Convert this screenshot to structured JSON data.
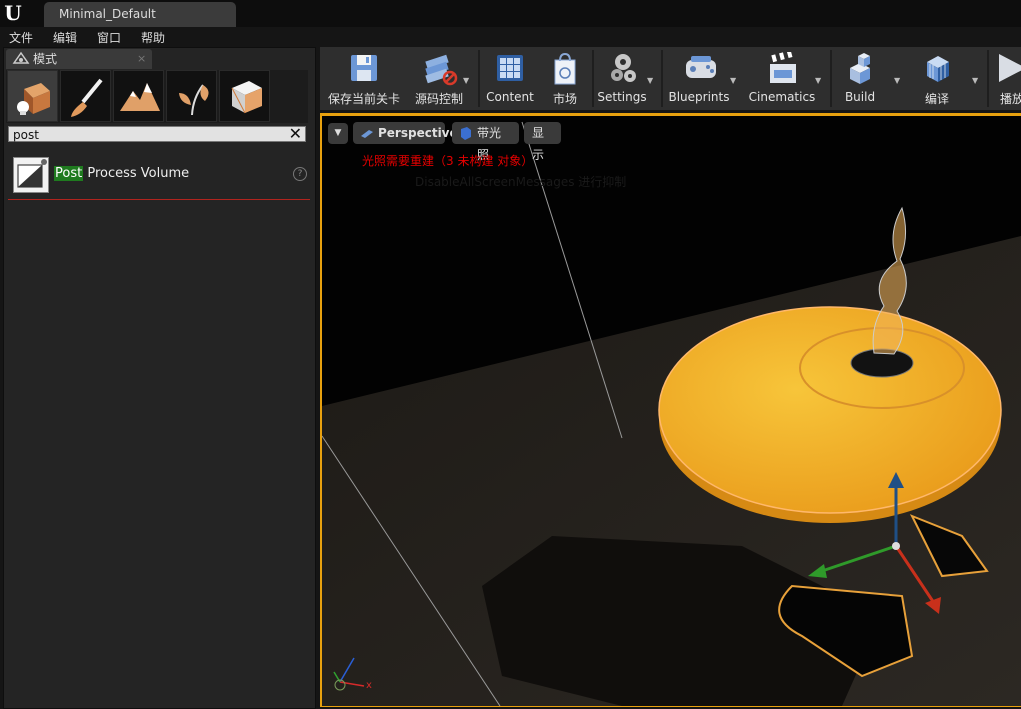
{
  "window": {
    "logo": "U",
    "tab_title": "Minimal_Default"
  },
  "menu": [
    "文件",
    "编辑",
    "窗口",
    "帮助"
  ],
  "modes_panel": {
    "tab_label": "模式",
    "tab_icon": "modes-icon",
    "close_glyph": "×",
    "mode_buttons": [
      "place-mode-icon",
      "paint-mode-icon",
      "landscape-mode-icon",
      "foliage-mode-icon",
      "geometry-mode-icon"
    ],
    "search": {
      "value": "post",
      "clear_glyph": "✕"
    },
    "results": [
      {
        "highlight": "Post",
        "rest": " Process Volume",
        "help": "?"
      }
    ]
  },
  "toolbar": {
    "buttons": [
      {
        "label": "保存当前关卡",
        "icon": "save-icon"
      },
      {
        "label": "源码控制",
        "icon": "source-control-icon"
      },
      {
        "label": "Content",
        "icon": "content-icon"
      },
      {
        "label": "市场",
        "icon": "marketplace-icon"
      },
      {
        "label": "Settings",
        "icon": "settings-icon"
      },
      {
        "label": "Blueprints",
        "icon": "blueprints-icon"
      },
      {
        "label": "Cinematics",
        "icon": "cinematics-icon"
      },
      {
        "label": "Build",
        "icon": "build-icon"
      },
      {
        "label": "编译",
        "icon": "compile-icon"
      },
      {
        "label": "播放",
        "icon": "play-icon"
      }
    ],
    "dropdown_glyph": "▼"
  },
  "viewport": {
    "menu_glyph": "▼",
    "perspective_label": "Perspective",
    "lit_label": "带光照",
    "show_label": "显示",
    "warning": "光照需要重建（3 未构建 对象）",
    "ghost_message": "DisableAllScreenMessages 进行抑制",
    "axis_x_label": "x",
    "accent_color": "#e8a10f"
  }
}
